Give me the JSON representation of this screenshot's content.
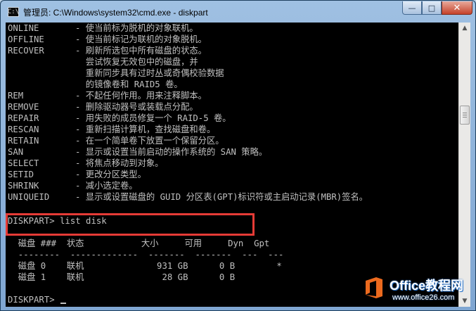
{
  "window": {
    "title": "管理员: C:\\Windows\\system32\\cmd.exe - diskpart",
    "icon_glyph": "C:\\",
    "controls": {
      "minimize": "—",
      "maximize": "□",
      "close": "✕"
    }
  },
  "console": {
    "help_lines": [
      {
        "cmd": "ONLINE",
        "desc": "- 使当前标为脱机的对象联机。"
      },
      {
        "cmd": "OFFLINE",
        "desc": "- 使当前标记为联机的对象脱机。"
      },
      {
        "cmd": "RECOVER",
        "desc": "- 刷新所选包中所有磁盘的状态。"
      },
      {
        "cmd": "",
        "desc": "  尝试恢复无效包中的磁盘，并"
      },
      {
        "cmd": "",
        "desc": "  重新同步具有过时丛或奇偶校验数据"
      },
      {
        "cmd": "",
        "desc": "  的镜像卷和 RAID5 卷。"
      },
      {
        "cmd": "REM",
        "desc": "- 不起任何作用。用来注释脚本。"
      },
      {
        "cmd": "REMOVE",
        "desc": "- 删除驱动器号或装载点分配。"
      },
      {
        "cmd": "REPAIR",
        "desc": "- 用失败的成员修复一个 RAID-5 卷。"
      },
      {
        "cmd": "RESCAN",
        "desc": "- 重新扫描计算机，查找磁盘和卷。"
      },
      {
        "cmd": "RETAIN",
        "desc": "- 在一个简单卷下放置一个保留分区。"
      },
      {
        "cmd": "SAN",
        "desc": "- 显示或设置当前启动的操作系统的 SAN 策略。"
      },
      {
        "cmd": "SELECT",
        "desc": "- 将焦点移动到对象。"
      },
      {
        "cmd": "SETID",
        "desc": "- 更改分区类型。"
      },
      {
        "cmd": "SHRINK",
        "desc": "- 减小选定卷。"
      },
      {
        "cmd": "UNIQUEID",
        "desc": "- 显示或设置磁盘的 GUID 分区表(GPT)标识符或主启动记录(MBR)签名。"
      }
    ],
    "command_line": "DISKPART> list disk",
    "table": {
      "header": "  磁盘 ###  状态           大小     可用     Dyn  Gpt",
      "separator": "  --------  -------------  -------  -------  ---  ---",
      "rows": [
        "  磁盘 0    联机              931 GB      0 B        *",
        "  磁盘 1    联机               28 GB      0 B"
      ]
    },
    "prompt": "DISKPART> "
  },
  "scrollbar": {
    "up": "▲",
    "down": "▼"
  },
  "watermark": {
    "title": "Office教程网",
    "url": "www.office26.com"
  }
}
